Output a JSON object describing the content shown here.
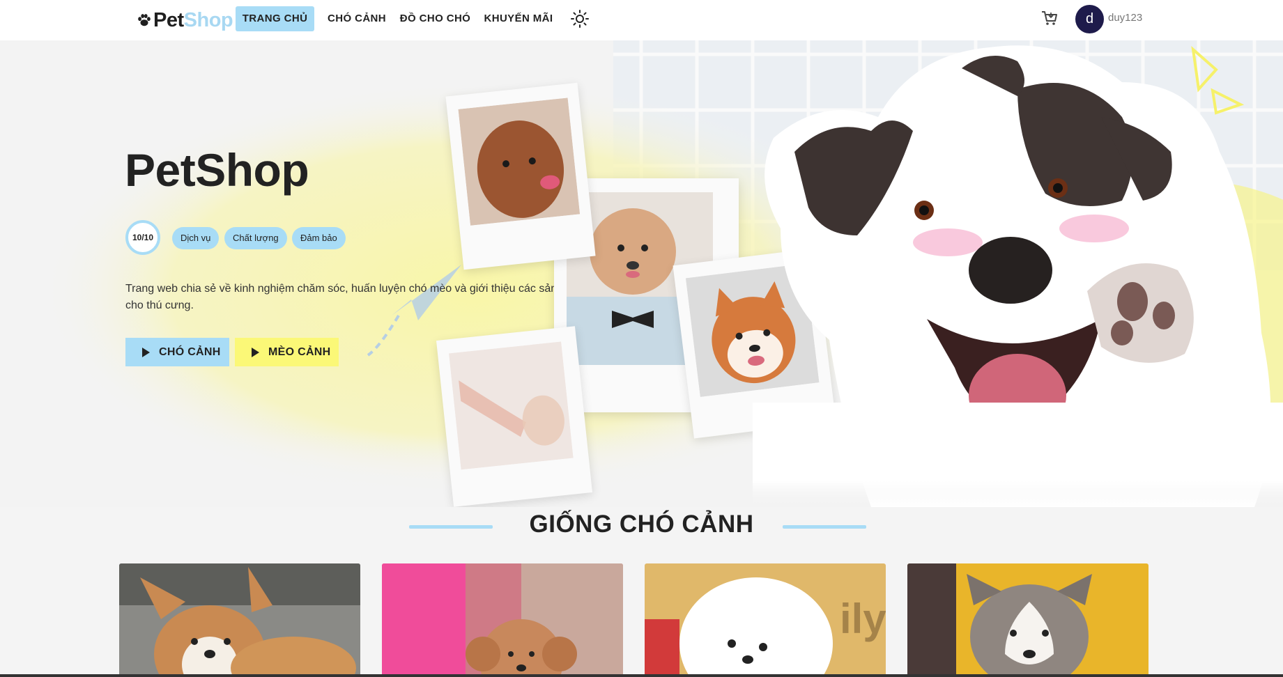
{
  "nav": {
    "logo_pet": "Pet",
    "logo_shop": "Shop",
    "items": [
      {
        "label": "TRANG CHỦ",
        "active": true
      },
      {
        "label": "CHÓ CẢNH",
        "active": false
      },
      {
        "label": "ĐỒ CHO CHÓ",
        "active": false
      },
      {
        "label": "KHUYẾN MÃI",
        "active": false
      }
    ],
    "theme_icon": "sun-icon",
    "cart_icon": "cart-icon",
    "avatar_initial": "d",
    "username": "duy123"
  },
  "hero": {
    "title": "PetShop",
    "score": "10/10",
    "tags": [
      "Dịch vụ",
      "Chất lượng",
      "Đảm bảo"
    ],
    "description": "Trang web chia sẻ về kinh nghiệm chăm sóc, huấn luyện chó mèo và giới thiệu các sản phẩm dịch vụ dành cho thú cưng.",
    "buttons": [
      {
        "label": "CHÓ CẢNH",
        "icon": "play-icon"
      },
      {
        "label": "MÈO CẢNH",
        "icon": "play-icon"
      }
    ]
  },
  "section": {
    "title": "GIỐNG CHÓ CẢNH"
  },
  "colors": {
    "accent_blue": "#a8dcf6",
    "accent_yellow": "#fbf877",
    "avatar_bg": "#1e1b4b",
    "text_dark": "#222222"
  }
}
